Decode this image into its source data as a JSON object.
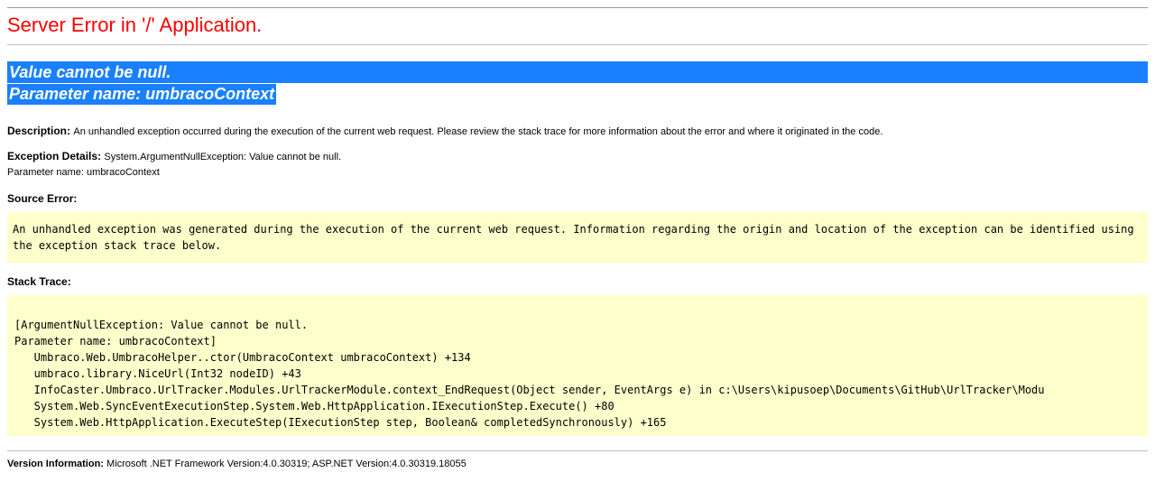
{
  "header": {
    "title": "Server Error in '/' Application."
  },
  "exception_banner": {
    "line1": "Value cannot be null.",
    "line2": "Parameter name: umbracoContext"
  },
  "description": {
    "label": "Description:",
    "text": "An unhandled exception occurred during the execution of the current web request. Please review the stack trace for more information about the error and where it originated in the code."
  },
  "exception_details": {
    "label": "Exception Details:",
    "text": "System.ArgumentNullException: Value cannot be null.\nParameter name: umbracoContext"
  },
  "source_error": {
    "label": "Source Error:",
    "box_text": "An unhandled exception was generated during the execution of the current web request. Information regarding the origin and location of the exception can be identified using the exception stack trace below."
  },
  "stack_trace": {
    "label": "Stack Trace:",
    "box_text": "\n[ArgumentNullException: Value cannot be null.\nParameter name: umbracoContext]\n   Umbraco.Web.UmbracoHelper..ctor(UmbracoContext umbracoContext) +134\n   umbraco.library.NiceUrl(Int32 nodeID) +43\n   InfoCaster.Umbraco.UrlTracker.Modules.UrlTrackerModule.context_EndRequest(Object sender, EventArgs e) in c:\\Users\\kipusoep\\Documents\\GitHub\\UrlTracker\\Modu\n   System.Web.SyncEventExecutionStep.System.Web.HttpApplication.IExecutionStep.Execute() +80\n   System.Web.HttpApplication.ExecuteStep(IExecutionStep step, Boolean& completedSynchronously) +165\n"
  },
  "version": {
    "label": "Version Information:",
    "text": "Microsoft .NET Framework Version:4.0.30319; ASP.NET Version:4.0.30319.18055"
  }
}
